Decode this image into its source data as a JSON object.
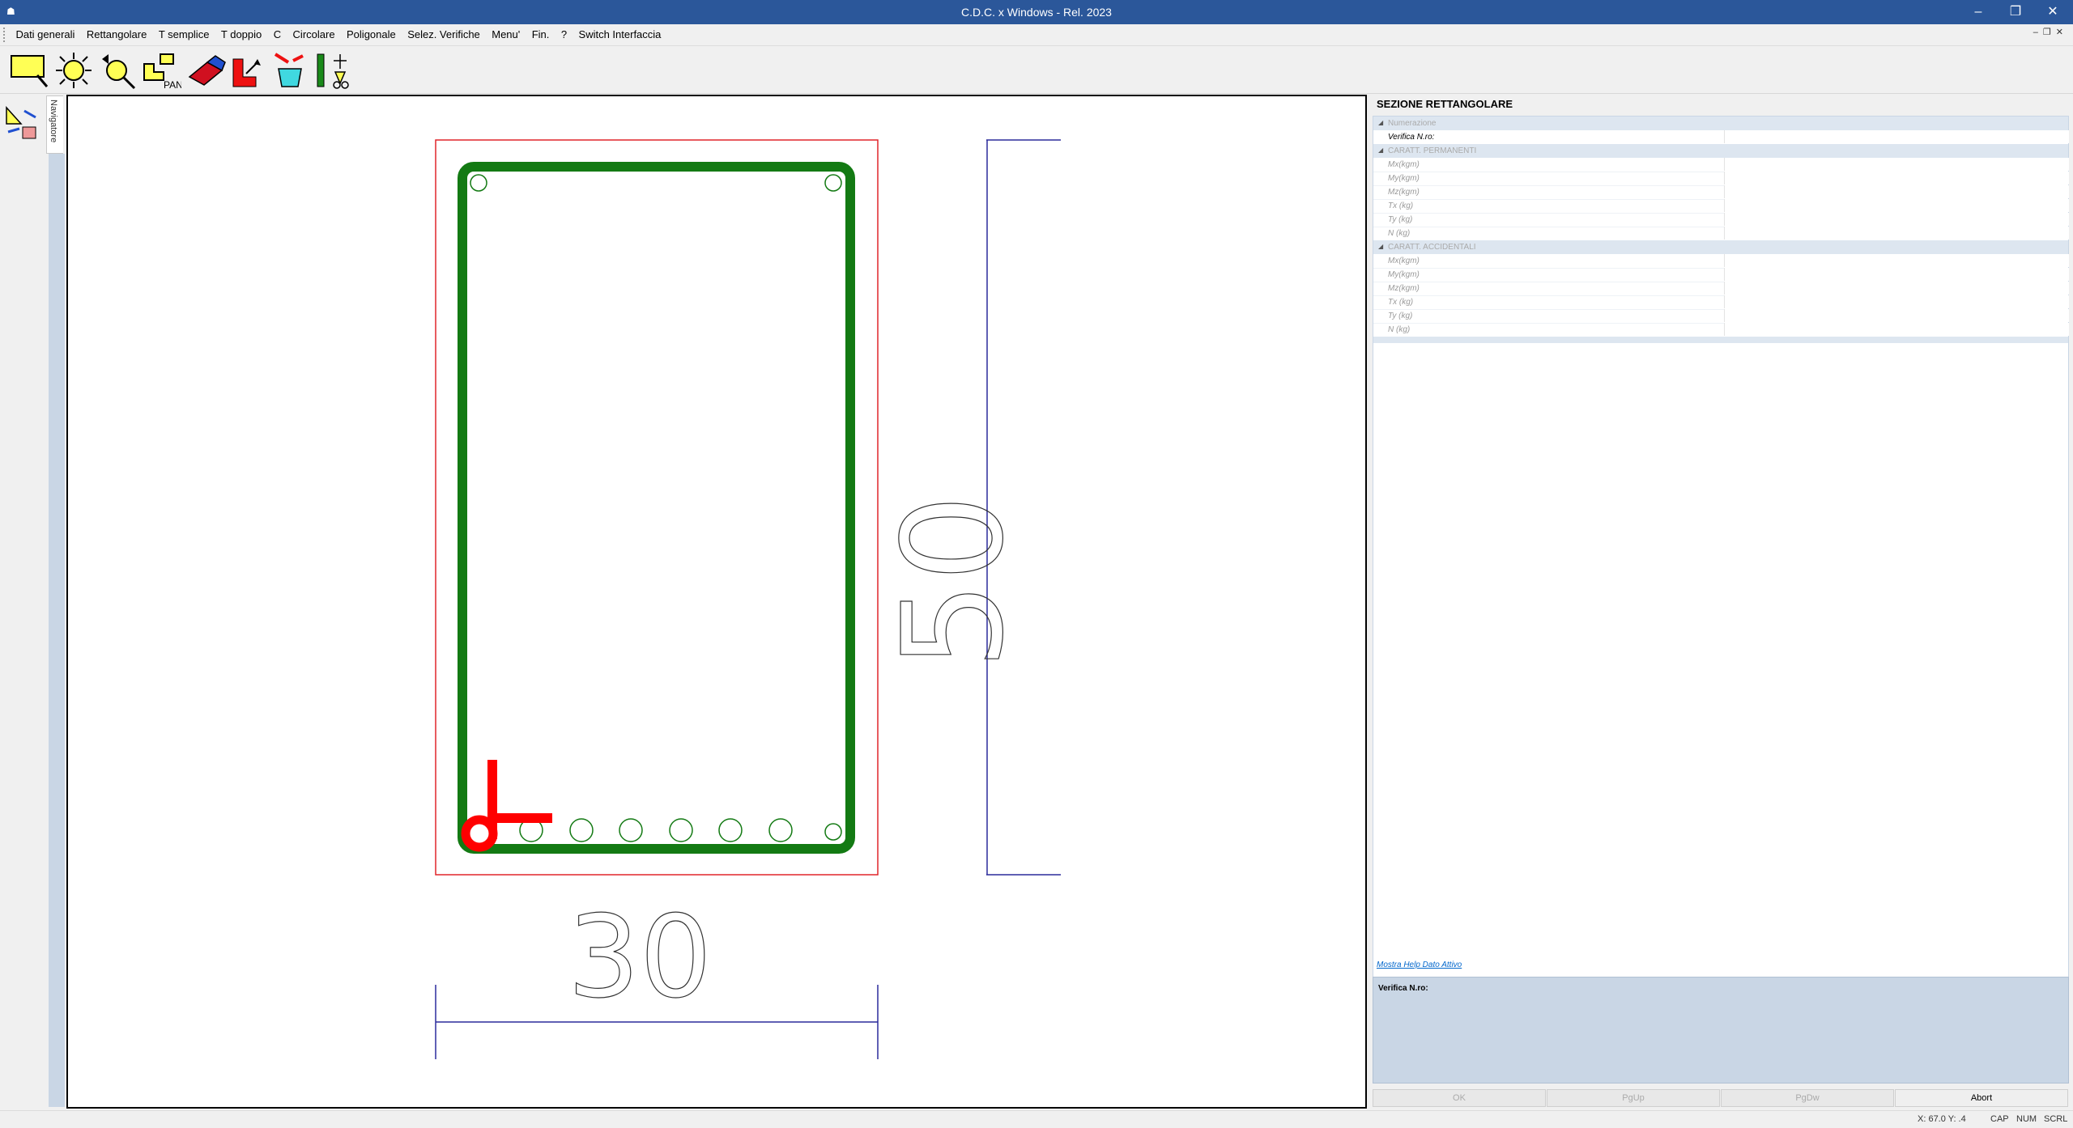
{
  "window": {
    "title": "C.D.C. x Windows - Rel. 2023",
    "minimize": "–",
    "restore": "❐",
    "close": "✕"
  },
  "menu": [
    "Dati generali",
    "Rettangolare",
    "T semplice",
    "T doppio",
    "C",
    "Circolare",
    "Poligonale",
    "Selez. Verifiche",
    "Menu'",
    "Fin.",
    "?",
    "Switch Interfaccia"
  ],
  "toolbar": {
    "tools": [
      "zoom-window-icon",
      "zoom-extents-icon",
      "zoom-dynamic-icon",
      "pan-icon",
      "eraser-icon",
      "section-shape-icon",
      "bucket-icon",
      "reinforcement-icon"
    ],
    "pan_label": "PAN"
  },
  "nav_tab": "Navigatore",
  "drawing": {
    "dim_width": "30",
    "dim_height": "50",
    "colors": {
      "outline": "#e0252a",
      "stirrup": "#137a13",
      "dimension": "#2b2b9c",
      "axis": "#ff0000"
    }
  },
  "panel": {
    "title": "SEZIONE RETTANGOLARE",
    "sections": [
      {
        "category": "Numerazione",
        "rows": [
          {
            "name": "Verifica N.ro:",
            "value": ""
          }
        ]
      },
      {
        "category": "CARATT. PERMANENTI",
        "rows": [
          {
            "name": "Mx(kgm)",
            "value": ""
          },
          {
            "name": "My(kgm)",
            "value": ""
          },
          {
            "name": "Mz(kgm)",
            "value": ""
          },
          {
            "name": "Tx (kg)",
            "value": ""
          },
          {
            "name": "Ty (kg)",
            "value": ""
          },
          {
            "name": "N  (kg)",
            "value": ""
          }
        ]
      },
      {
        "category": "CARATT. ACCIDENTALI",
        "rows": [
          {
            "name": "Mx(kgm)",
            "value": ""
          },
          {
            "name": "My(kgm)",
            "value": ""
          },
          {
            "name": "Mz(kgm)",
            "value": ""
          },
          {
            "name": "Tx (kg)",
            "value": ""
          },
          {
            "name": "Ty (kg)",
            "value": ""
          },
          {
            "name": "N  (kg)",
            "value": ""
          }
        ]
      }
    ],
    "help_link": "Mostra Help Dato Attivo",
    "help_title": "Verifica N.ro:",
    "buttons": {
      "ok": "OK",
      "pgup": "PgUp",
      "pgdw": "PgDw",
      "abort": "Abort"
    }
  },
  "status": {
    "coords": "X: 67.0  Y:  .4",
    "cap": "CAP",
    "num": "NUM",
    "scrl": "SCRL"
  }
}
